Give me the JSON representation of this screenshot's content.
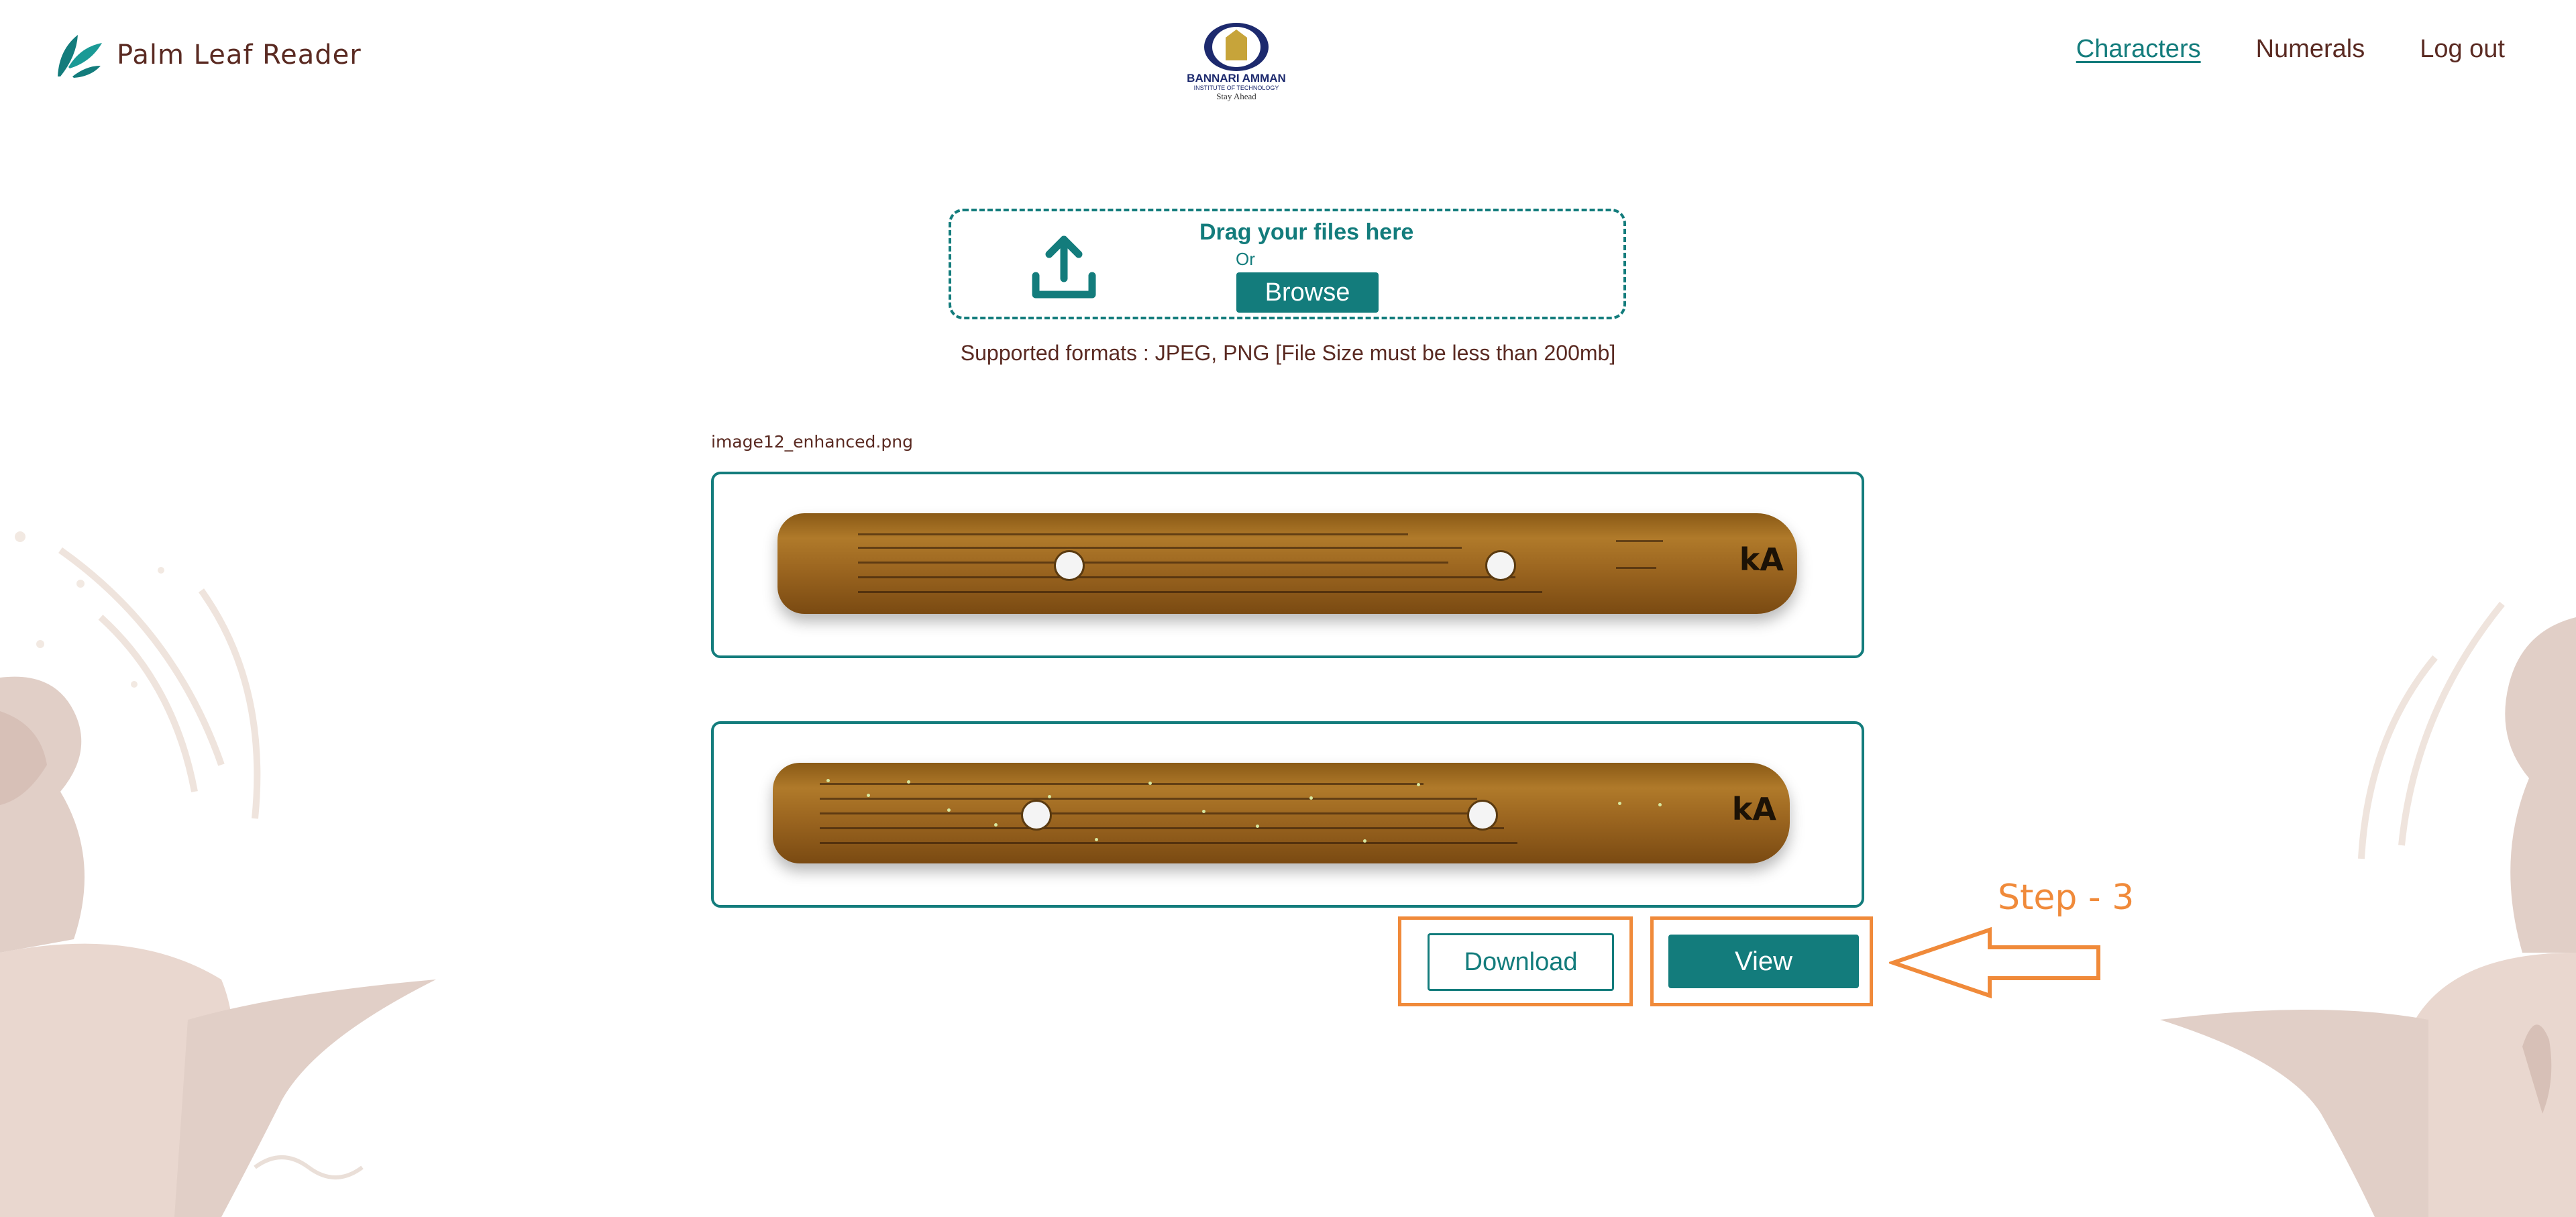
{
  "header": {
    "brand_name": "Palm Leaf Reader",
    "institution": {
      "name": "BANNARI AMMAN",
      "subtitle": "INSTITUTE OF TECHNOLOGY",
      "tagline": "Stay Ahead"
    },
    "nav": [
      {
        "label": "Characters",
        "active": true
      },
      {
        "label": "Numerals",
        "active": false
      },
      {
        "label": "Log out",
        "active": false
      }
    ]
  },
  "upload": {
    "drag_text": "Drag your files here",
    "or_text": "Or",
    "browse_label": "Browse",
    "formats_note": "Supported formats : JPEG, PNG [File Size must be less than 200mb]"
  },
  "files": {
    "filename": "image12_enhanced.png",
    "original_leaf_tag": "kA",
    "enhanced_leaf_tag": "kA"
  },
  "actions": {
    "download_label": "Download",
    "view_label": "View"
  },
  "annotation": {
    "step_label": "Step - 3"
  },
  "colors": {
    "accent": "#137c7c",
    "text_brown": "#5a2a22",
    "annotation_orange": "#f08a3a"
  },
  "icons": {
    "brand": "leaf-logo-icon",
    "upload": "upload-arrow-icon",
    "arrow": "left-arrow-annotation"
  }
}
